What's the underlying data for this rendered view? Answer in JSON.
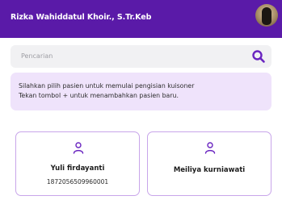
{
  "header": {
    "title": "Rizka Wahiddatul Khoir., S.Tr.Keb",
    "avatar_icon": "user-photo-avatar"
  },
  "search": {
    "placeholder": "Pencarian",
    "icon": "search-icon"
  },
  "info": {
    "line1": "Silahkan pilih pasien untuk memulai pengisian kuisoner",
    "line2": "Tekan tombol + untuk menambahkan pasien baru."
  },
  "patients": [
    {
      "name": "Yuli firdayanti",
      "id": "1872056509960001",
      "icon": "person-icon"
    },
    {
      "name": "Meiliya kurniawati",
      "id": "",
      "icon": "person-icon"
    }
  ],
  "colors": {
    "appbar": "#5a1aa8",
    "accent": "#6a25c0",
    "info_bg": "#efe3fb",
    "card_border": "#c8a5ea"
  }
}
